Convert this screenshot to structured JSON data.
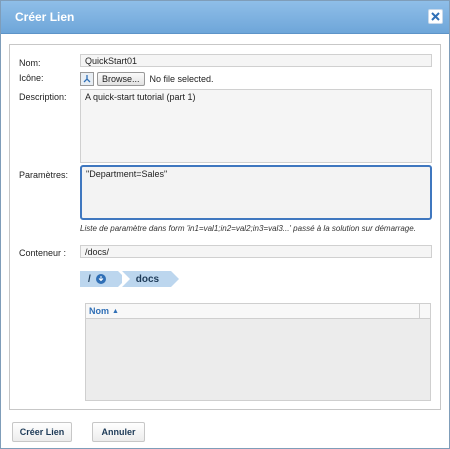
{
  "dialog": {
    "title": "Créer Lien",
    "close_icon": "close-icon"
  },
  "form": {
    "name_label": "Nom:",
    "name_value": "QuickStart01",
    "icon_label": "Icône:",
    "browse_label": "Browse...",
    "no_file_text": "No file selected.",
    "description_label": "Description:",
    "description_value": "A quick-start tutorial (part 1)",
    "params_label": "Paramètres:",
    "params_value": "\"Department=Sales\"",
    "params_hint": "Liste de paramètre dans form 'in1=val1;in2=val2;in3=val3...' passé à la solution sur démarrage.",
    "container_label": "Conteneur :",
    "container_value": "/docs/"
  },
  "breadcrumb": {
    "items": [
      "/",
      "docs"
    ],
    "icons": [
      "download-icon"
    ]
  },
  "table": {
    "columns": [
      "Nom"
    ],
    "sort_icon": "sort-ascending-icon",
    "rows": []
  },
  "footer": {
    "create_label": "Créer Lien",
    "cancel_label": "Annuler"
  }
}
